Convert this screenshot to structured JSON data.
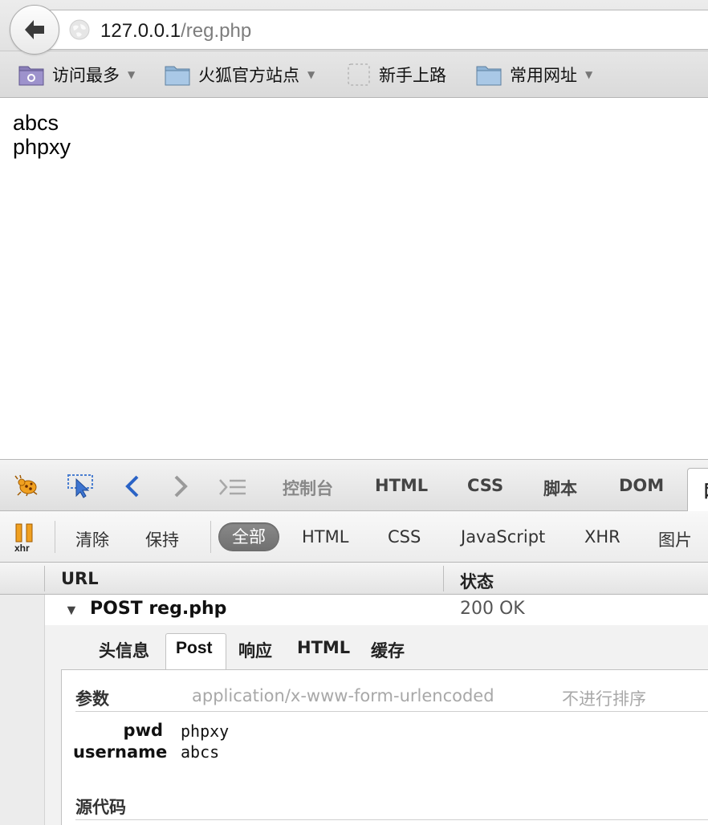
{
  "browser": {
    "url_host": "127.0.0.1",
    "url_path": "/reg.php"
  },
  "bookmarks": [
    {
      "label": "访问最多",
      "icon": "folder-gear-icon",
      "dropdown": true
    },
    {
      "label": "火狐官方站点",
      "icon": "folder-icon",
      "dropdown": true
    },
    {
      "label": "新手上路",
      "icon": "dashed-box-icon",
      "dropdown": false
    },
    {
      "label": "常用网址",
      "icon": "folder-icon",
      "dropdown": true
    }
  ],
  "page": {
    "lines": [
      "abcs",
      "phpxy"
    ]
  },
  "firebug": {
    "tabs": [
      "控制台",
      "HTML",
      "CSS",
      "脚本",
      "DOM"
    ],
    "active_tab_partial": "网",
    "tools": [
      "firebug-bug-icon",
      "inspect-cursor-icon",
      "back-arrow-icon",
      "forward-arrow-icon",
      "command-line-icon"
    ],
    "net_toolbar": {
      "xhr_label": "xhr",
      "clear": "清除",
      "persist": "保持",
      "filters": [
        "全部",
        "HTML",
        "CSS",
        "JavaScript",
        "XHR",
        "图片"
      ],
      "active_filter": "全部"
    },
    "columns": {
      "url": "URL",
      "status": "状态"
    },
    "request": {
      "method_and_file": "POST reg.php",
      "status": "200 OK"
    },
    "detail_tabs": [
      "头信息",
      "Post",
      "响应",
      "HTML",
      "缓存"
    ],
    "active_detail_tab": "Post",
    "params_section": {
      "title": "参数",
      "content_type": "application/x-www-form-urlencoded",
      "sort_option": "不进行排序",
      "params": [
        {
          "key": "pwd",
          "value": "phpxy"
        },
        {
          "key": "username",
          "value": "abcs"
        }
      ]
    },
    "source_section": {
      "title": "源代码"
    },
    "colors": {
      "accent_blue": "#2a63c6",
      "pill": "#7a7a7a"
    }
  }
}
